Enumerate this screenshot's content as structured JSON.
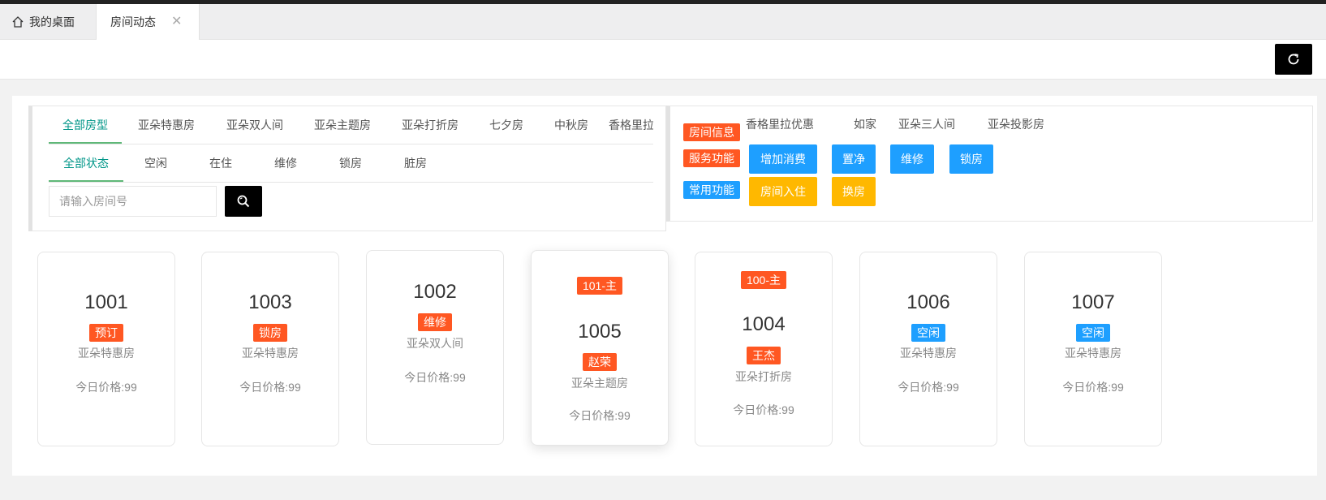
{
  "tabs": {
    "home_label": "我的桌面",
    "active_label": "房间动态",
    "close_glyph": "✕"
  },
  "filters": {
    "room_types": [
      "全部房型",
      "亚朵特惠房",
      "亚朵双人间",
      "亚朵主题房",
      "亚朵打折房",
      "七夕房",
      "中秋房",
      "香格里拉单人",
      "香格里拉优惠",
      "如家",
      "亚朵三人间",
      "亚朵投影房"
    ],
    "statuses": [
      "全部状态",
      "空闲",
      "在住",
      "维修",
      "锁房",
      "脏房"
    ],
    "search_placeholder": "请输入房间号"
  },
  "actions": {
    "room_info_label": "房间信息",
    "service_label": "服务功能",
    "common_label": "常用功能",
    "service_buttons": [
      "增加消费",
      "置净",
      "维修",
      "锁房"
    ],
    "common_buttons": [
      "房间入住",
      "换房"
    ]
  },
  "rooms": [
    {
      "number": "1001",
      "status": "预订",
      "status_color": "#FF5722",
      "type": "亚朵特惠房",
      "price": "今日价格:99"
    },
    {
      "number": "1003",
      "status": "锁房",
      "status_color": "#FF5722",
      "type": "亚朵特惠房",
      "price": "今日价格:99"
    },
    {
      "number": "1002",
      "status": "维修",
      "status_color": "#FF5722",
      "type": "亚朵双人间",
      "price": "今日价格:99"
    },
    {
      "number": "1005",
      "master": "101-主",
      "status": "赵荣",
      "status_color": "#FF5722",
      "type": "亚朵主题房",
      "price": "今日价格:99"
    },
    {
      "number": "1004",
      "master": "100-主",
      "status": "王杰",
      "status_color": "#FF5722",
      "type": "亚朵打折房",
      "price": "今日价格:99"
    },
    {
      "number": "1006",
      "status": "空闲",
      "status_color": "#1E9FFF",
      "type": "亚朵特惠房",
      "price": "今日价格:99"
    },
    {
      "number": "1007",
      "status": "空闲",
      "status_color": "#1E9FFF",
      "type": "亚朵特惠房",
      "price": "今日价格:99"
    }
  ],
  "colors": {
    "accent_green": "#009688",
    "danger": "#FF5722",
    "normal_blue": "#1E9FFF",
    "warm_yellow": "#FFB800"
  },
  "icons": {
    "home": "home-icon",
    "close": "close-icon",
    "refresh": "refresh-icon",
    "search": "search-icon"
  }
}
